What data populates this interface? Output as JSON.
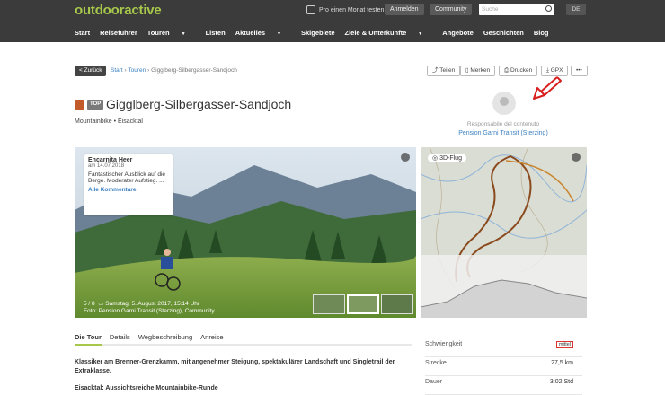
{
  "header": {
    "logo": "outdooractive",
    "pro_text": "Pro einen Monat testen",
    "login": "Anmelden",
    "community": "Community",
    "search_placeholder": "Suche",
    "lang": "DE",
    "nav": [
      "Start",
      "Reiseführer",
      "Touren",
      "Listen",
      "Aktuelles",
      "Skigebiete",
      "Ziele & Unterkünfte",
      "Angebote",
      "Geschichten",
      "Blog"
    ]
  },
  "toolbar": {
    "back": "< Zurück",
    "breadcrumb_start": "Start",
    "breadcrumb_tours": "Touren",
    "breadcrumb_current": "Gigglberg-Silbergasser-Sandjoch",
    "share": "Teilen",
    "bookmark": "Merken",
    "print": "Drucken",
    "gpx": "GPX",
    "more": "•••"
  },
  "tour": {
    "top_badge": "TOP",
    "title": "Gigglberg-Silbergasser-Sandjoch",
    "subtitle": "Mountainbike • Eisacktal",
    "responsible_label": "Responsabile del contenuto",
    "responsible_name": "Pension Garni Transit (Sterzing)"
  },
  "comment": {
    "author": "Encarnita Heer",
    "date": "am 14.07.2018",
    "text": "Fantastischer Ausblick auf die Berge. Moderater Aufstieg. ...",
    "link": "Alle Kommentare"
  },
  "photo": {
    "counter": "5 / 8",
    "date": "Samstag, 5. August 2017, 15:14 Uhr",
    "credit": "Foto: Pension Garni Transit (Sterzing), Community"
  },
  "map": {
    "flug_button": "3D-Flug"
  },
  "tabs": [
    "Die Tour",
    "Details",
    "Wegbeschreibung",
    "Anreise"
  ],
  "description": {
    "intro": "Klassiker am Brenner-Grenzkamm, mit angenehmer Steigung, spektakulärer Landschaft und Singletrail der Extraklasse.",
    "heading": "Eisacktal: Aussichtsreiche Mountainbike-Runde"
  },
  "stats": [
    {
      "label": "Schwierigkeit",
      "value": "mittel"
    },
    {
      "label": "Strecke",
      "value": "27,5 km"
    },
    {
      "label": "Dauer",
      "value": "3:02 Std"
    }
  ],
  "colors": {
    "accent": "#a7c84a",
    "link": "#3a7fc0",
    "header_bg": "#3b3b3b"
  }
}
